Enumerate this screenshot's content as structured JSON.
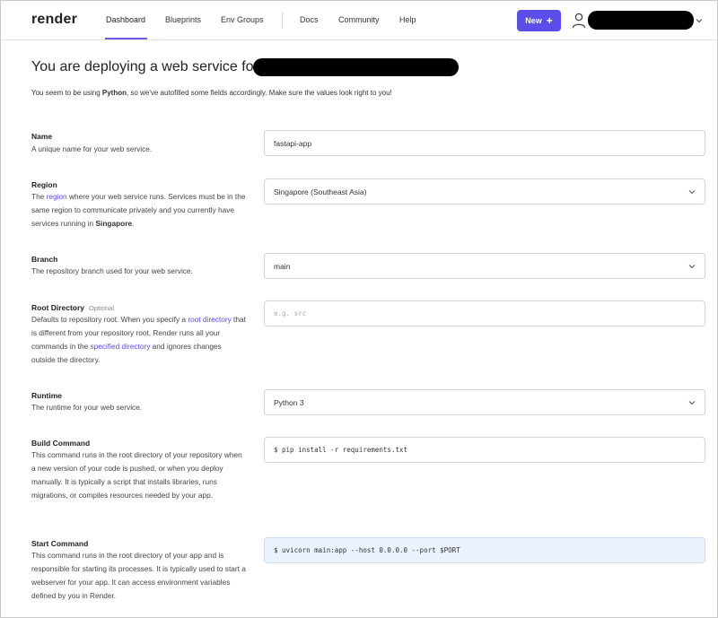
{
  "nav": {
    "logo": "render",
    "links": [
      "Dashboard",
      "Blueprints",
      "Env Groups"
    ],
    "links2": [
      "Docs",
      "Community",
      "Help"
    ],
    "new_button": "New",
    "new_plus": "+"
  },
  "header": {
    "title": "You are deploying a web service fo",
    "subtitle_pre": "You seem to be using ",
    "subtitle_bold": "Python",
    "subtitle_post": ", so we've autofilled some fields accordingly. Make sure the values look right to you!"
  },
  "fields": {
    "name": {
      "label": "Name",
      "desc": "A unique name for your web service.",
      "value": "fastapi-app"
    },
    "region": {
      "label": "Region",
      "desc_1": "The ",
      "desc_link": "region",
      "desc_2": " where your web service runs. Services must be in the same region to communicate privately and you currently have services running in ",
      "desc_bold": "Singapore",
      "desc_3": ".",
      "value": "Singapore (Southeast Asia)"
    },
    "branch": {
      "label": "Branch",
      "desc": "The repository branch used for your web service.",
      "value": "main"
    },
    "root_dir": {
      "label": "Root Directory",
      "optional": "Optional",
      "desc_1": "Defaults to repository root. When you specify a ",
      "desc_link1": "root directory",
      "desc_2": " that is different from your repository root, Render runs all your commands in the ",
      "desc_link2": "specified directory",
      "desc_3": " and ignores changes outside the directory.",
      "placeholder": "e.g. src"
    },
    "runtime": {
      "label": "Runtime",
      "desc": "The runtime for your web service.",
      "value": "Python 3"
    },
    "build": {
      "label": "Build Command",
      "desc": "This command runs in the root directory of your repository when a new version of your code is pushed, or when you deploy manually. It is typically a script that installs libraries, runs migrations, or compiles resources needed by your app.",
      "value": "$  pip install -r requirements.txt"
    },
    "start": {
      "label": "Start Command",
      "desc": "This command runs in the root directory of your app and is responsible for starting its processes. It is typically used to start a webserver for your app. It can access environment variables defined by you in Render.",
      "value": "$  uvicorn main:app --host 0.0.0.0 --port $PORT"
    }
  },
  "icons": {
    "user": "user-icon",
    "chevron": "chevron-down-icon"
  },
  "colors": {
    "accent": "#5b4ee8",
    "highlight_field": "#eaf2fd"
  }
}
